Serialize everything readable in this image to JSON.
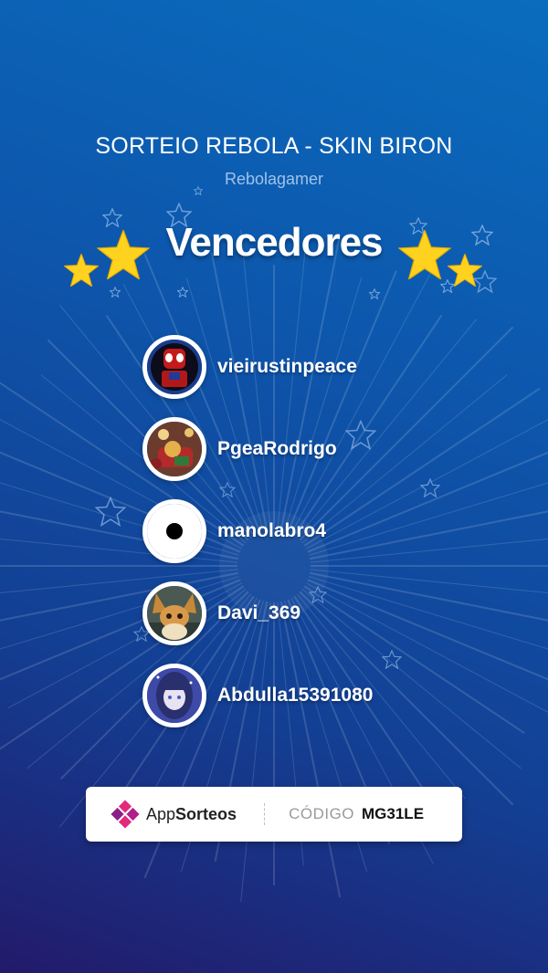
{
  "header": {
    "title": "SORTEIO REBOLA - SKIN BIRON",
    "subtitle": "Rebolagamer",
    "heading": "Vencedores"
  },
  "winners": [
    {
      "name": "vieirustinpeace",
      "avatar": "spider-lego-avatar"
    },
    {
      "name": "PgeaRodrigo",
      "avatar": "christmas-figure-avatar"
    },
    {
      "name": "manolabro4",
      "avatar": "dot-avatar"
    },
    {
      "name": "Davi_369",
      "avatar": "fox-creature-avatar"
    },
    {
      "name": "Abdulla15391080",
      "avatar": "anime-girl-avatar"
    }
  ],
  "footer": {
    "brand_prefix": "App",
    "brand_bold": "Sorteos",
    "code_label": "CÓDIGO",
    "code_value": "MG31LE"
  },
  "colors": {
    "bg_top": "#0a6cbd",
    "bg_bottom": "#231a6b",
    "star_gold": "#ffd21f",
    "brand_pink": "#e2297d"
  }
}
